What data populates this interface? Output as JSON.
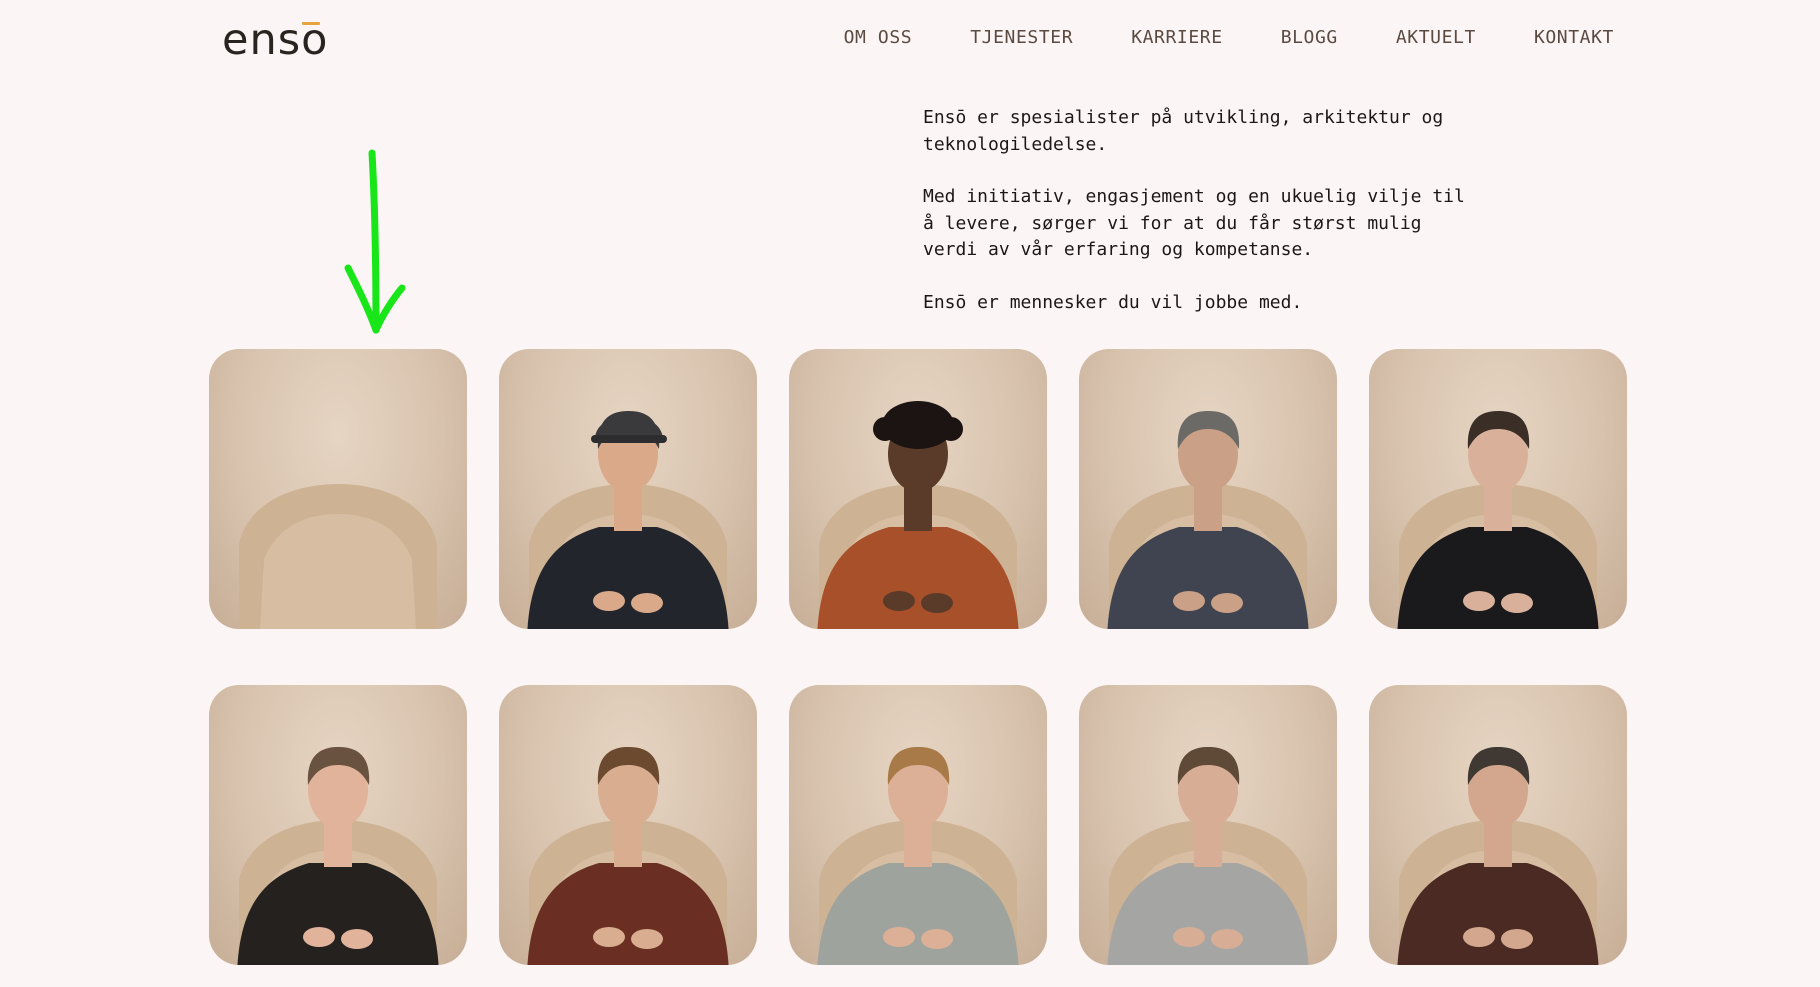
{
  "logo": {
    "text": "enso",
    "accent_color": "#e8a43c"
  },
  "nav": {
    "items": [
      {
        "label": "OM OSS"
      },
      {
        "label": "TJENESTER"
      },
      {
        "label": "KARRIERE"
      },
      {
        "label": "BLOGG"
      },
      {
        "label": "AKTUELT"
      },
      {
        "label": "KONTAKT"
      }
    ]
  },
  "intro": {
    "paragraphs": [
      "Ensō er spesialister på utvikling, arkitektur og\nteknologiledelse.",
      "Med initiativ, engasjement og en ukuelig vilje til\nå levere, sørger vi for at du får størst mulig\nverdi av vår erfaring og kompetanse.",
      "Ensō er mennesker du vil jobbe med."
    ]
  },
  "annotation": {
    "arrow_color": "#19e619"
  },
  "team": {
    "photos": [
      {
        "name": "empty-chair",
        "kind": "chair"
      },
      {
        "name": "person-cap",
        "kind": "person",
        "top": "#22252c",
        "skin": "#d9a98a",
        "hair": "#3a3a3d",
        "cap": true
      },
      {
        "name": "person-orange-sweater",
        "kind": "person",
        "top": "#a8502a",
        "skin": "#5a3a28",
        "hair": "#1c1412",
        "curly": true
      },
      {
        "name": "person-grey-shirt",
        "kind": "person",
        "top": "#3f4450",
        "skin": "#caa087",
        "hair": "#6c6a66"
      },
      {
        "name": "person-black-tee",
        "kind": "person",
        "top": "#1a1a1c",
        "skin": "#d9b19a",
        "hair": "#3b2e27"
      },
      {
        "name": "person-black-shirt",
        "kind": "person",
        "top": "#24211f",
        "skin": "#e0b39a",
        "hair": "#6a5240"
      },
      {
        "name": "person-red-shirt",
        "kind": "person",
        "top": "#6a2e22",
        "skin": "#d9ad90",
        "hair": "#6b4a30"
      },
      {
        "name": "person-grey-sweater",
        "kind": "person",
        "top": "#9ea39e",
        "skin": "#dcb096",
        "hair": "#a87a48"
      },
      {
        "name": "person-light-sweater",
        "kind": "person",
        "top": "#a5a6a3",
        "skin": "#d7ae95",
        "hair": "#5f4a38"
      },
      {
        "name": "person-brown-sweater",
        "kind": "person",
        "top": "#4a2a22",
        "skin": "#d2a78e",
        "hair": "#3f3833"
      }
    ]
  }
}
